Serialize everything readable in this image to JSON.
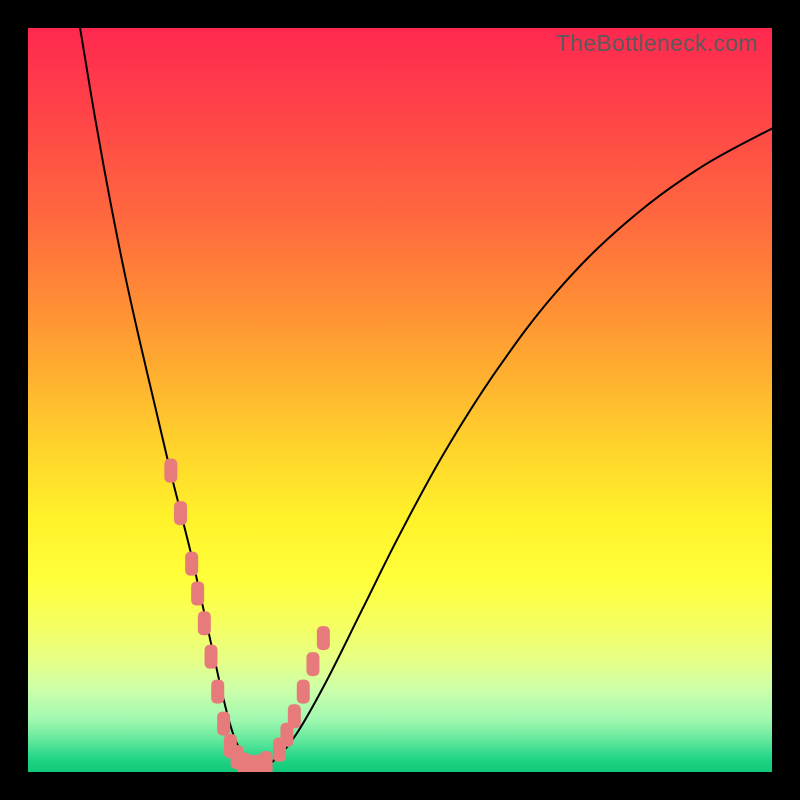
{
  "watermark": "TheBottleneck.com",
  "chart_data": {
    "type": "line",
    "title": "",
    "xlabel": "",
    "ylabel": "",
    "xlim": [
      0,
      100
    ],
    "ylim": [
      0,
      100
    ],
    "series": [
      {
        "name": "curve",
        "x": [
          7,
          9,
          11,
          13,
          15,
          17,
          19,
          20.5,
          22,
          23,
          24,
          25,
          26,
          27,
          28,
          29.5,
          31,
          33,
          36,
          40,
          45,
          50,
          56,
          63,
          71,
          80,
          90,
          100
        ],
        "y": [
          100,
          88,
          77,
          67,
          58,
          49.5,
          41,
          35,
          29,
          24.5,
          20,
          15.5,
          11,
          7,
          4,
          1.5,
          0.5,
          1.5,
          5,
          12,
          22,
          32,
          43,
          54,
          64.5,
          73.5,
          81,
          86.5
        ]
      },
      {
        "name": "markers-left",
        "x": [
          19.2,
          20.5,
          22.0,
          22.8,
          23.7,
          24.6,
          25.5,
          26.3
        ],
        "y": [
          40.5,
          34.8,
          28.0,
          24.0,
          20.0,
          15.5,
          10.8,
          6.5
        ]
      },
      {
        "name": "markers-bottom",
        "x": [
          27.2,
          28.1,
          29.0,
          30.0,
          31.0,
          32.0
        ],
        "y": [
          3.5,
          2.0,
          1.0,
          0.7,
          0.7,
          1.2
        ]
      },
      {
        "name": "markers-right",
        "x": [
          33.8,
          34.8,
          35.8,
          37.0,
          38.3,
          39.7
        ],
        "y": [
          3.0,
          5.0,
          7.5,
          10.8,
          14.5,
          18.0
        ]
      }
    ],
    "marker_color": "#e77b7b",
    "curve_color": "#000000"
  }
}
